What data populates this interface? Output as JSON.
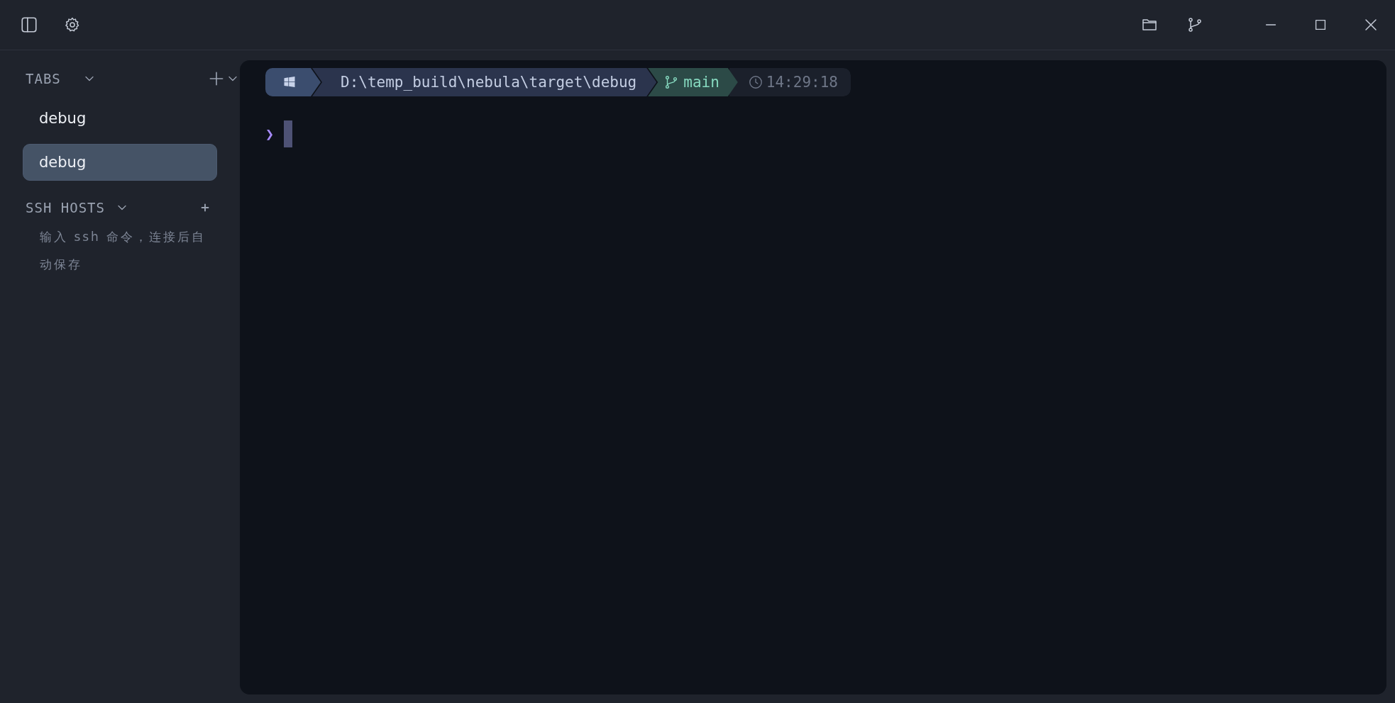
{
  "sidebar": {
    "tabs_header": "TABS",
    "tabs": [
      {
        "label": "debug",
        "selected": false
      },
      {
        "label": "debug",
        "selected": true
      }
    ],
    "ssh_header": "SSH HOSTS",
    "ssh_hint": "输入 ssh 命令，连接后自动保存"
  },
  "terminal": {
    "path": "D:\\temp_build\\nebula\\target\\debug",
    "branch": "main",
    "time": "14:29:18",
    "prompt_symbol": "❯"
  }
}
